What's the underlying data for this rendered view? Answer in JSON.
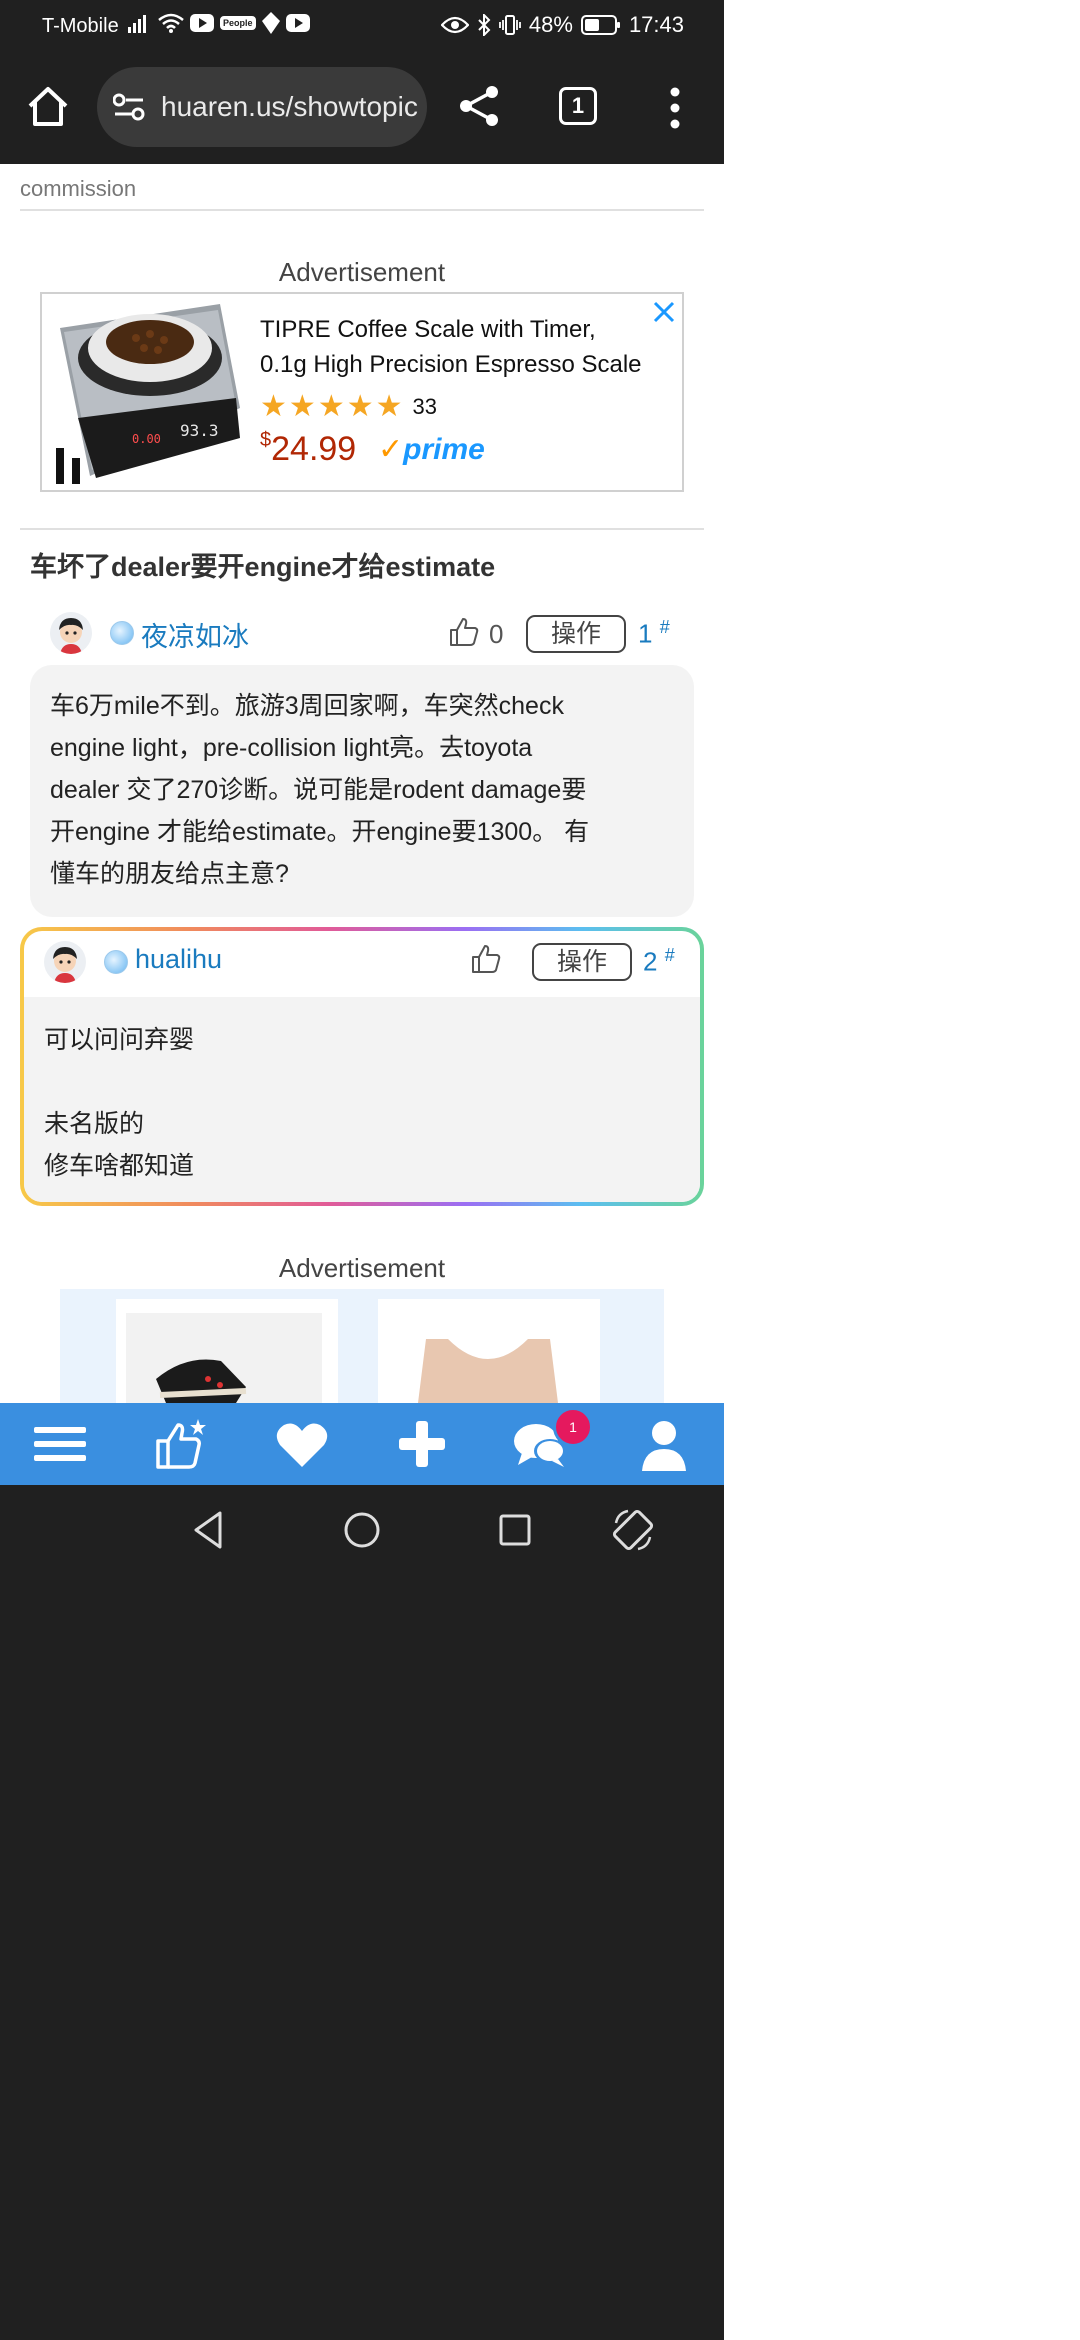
{
  "status_bar": {
    "carrier": "T-Mobile",
    "people_badge": "People",
    "battery": "48%",
    "time": "17:43"
  },
  "browser": {
    "url": "huaren.us/showtopic",
    "tab_count": "1"
  },
  "content": {
    "commission_text": "commission",
    "ad_label_1": "Advertisement",
    "ad1": {
      "title_line1": "TIPRE Coffee Scale with Timer,",
      "title_line2": "0.1g High Precision Espresso Scale",
      "rating_count": "33",
      "price_currency": "$",
      "price_value": "24.99",
      "prime_label": "prime",
      "stars": 5
    },
    "thread_title": "车坏了dealer要开engine才给estimate",
    "posts": [
      {
        "username": "夜凉如冰",
        "like_count": "0",
        "op_label": "操作",
        "floor": "1",
        "floor_mark": "#",
        "body_lines": [
          "车6万mile不到。旅游3周回家啊，车突然check",
          "engine light，pre-collision light亮。去toyota",
          "dealer 交了270诊断。说可能是rodent damage要",
          "开engine 才能给estimate。开engine要1300。 有",
          "懂车的朋友给点主意?"
        ]
      },
      {
        "username": "hualihu",
        "op_label": "操作",
        "floor": "2",
        "floor_mark": "#",
        "body_lines": [
          "可以问问弃婴",
          "",
          "未名版的",
          "修车啥都知道"
        ]
      }
    ],
    "ad_label_2": "Advertisement"
  },
  "bottom_nav": {
    "items": [
      "menu-icon",
      "thumbs-up-star-icon",
      "heart-icon",
      "plus-icon",
      "chat-icon",
      "user-icon"
    ],
    "chat_badge": "1"
  },
  "colors": {
    "nav_blue": "#3a8fe0",
    "link_blue": "#1a7bbf",
    "badge_pink": "#e5195e"
  }
}
